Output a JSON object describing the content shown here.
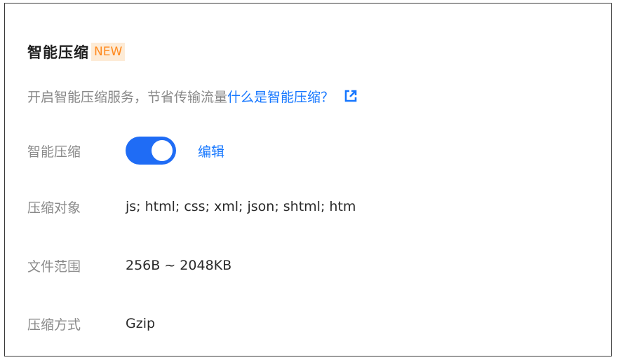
{
  "section": {
    "title": "智能压缩",
    "badge": "NEW",
    "description": "开启智能压缩服务，节省传输流量",
    "help_link": "什么是智能压缩？",
    "help_icon": "external-link-icon"
  },
  "settings": {
    "toggle_label": "智能压缩",
    "toggle_state": true,
    "edit_label": "编辑",
    "target": {
      "label": "压缩对象",
      "value": "js; html; css; xml; json; shtml; htm"
    },
    "file_range": {
      "label": "文件范围",
      "value": "256B ~ 2048KB"
    },
    "method": {
      "label": "压缩方式",
      "value": "Gzip"
    }
  },
  "colors": {
    "accent": "#1677ff",
    "toggle_on": "#1f6cf5",
    "badge_text": "#ff8a1f",
    "badge_bg": "#fdebd6",
    "label_text": "#8a8a8a"
  }
}
